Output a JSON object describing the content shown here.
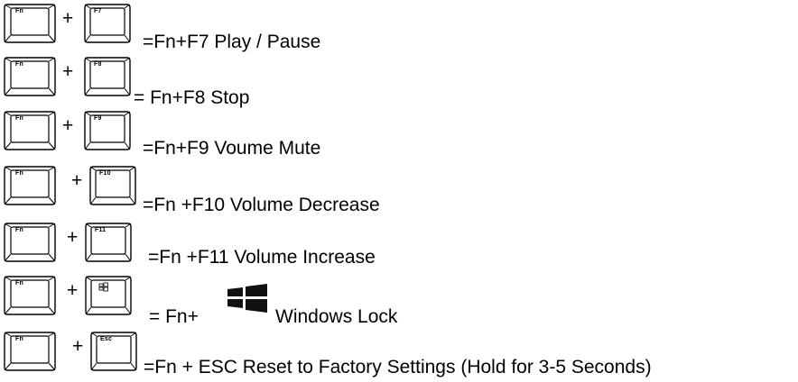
{
  "rows": [
    {
      "key1": "Fn",
      "plus": "+",
      "key2": "F7",
      "desc": "=Fn+F7 Play / Pause"
    },
    {
      "key1": "Fn",
      "plus": "+",
      "key2": "F8",
      "desc": "= Fn+F8 Stop"
    },
    {
      "key1": "Fn",
      "plus": "+",
      "key2": "F9",
      "desc": "=Fn+F9 Voume Mute"
    },
    {
      "key1": "Fn",
      "plus": "+",
      "key2": "F10",
      "desc": "=Fn +F10 Volume Decrease"
    },
    {
      "key1": "Fn",
      "plus": "+",
      "key2": "F11",
      "desc": "=Fn +F11 Volume Increase"
    },
    {
      "key1": "Fn",
      "plus": "+",
      "key2_icon": "windows-logo-icon",
      "desc_prefix": "= Fn+",
      "icon": "windows-logo-icon",
      "desc_suffix": "Windows Lock"
    },
    {
      "key1": "Fn",
      "plus": "+",
      "key2": "Esc",
      "desc": "=Fn + ESC Reset to Factory Settings (Hold for 3-5 Seconds)"
    }
  ]
}
